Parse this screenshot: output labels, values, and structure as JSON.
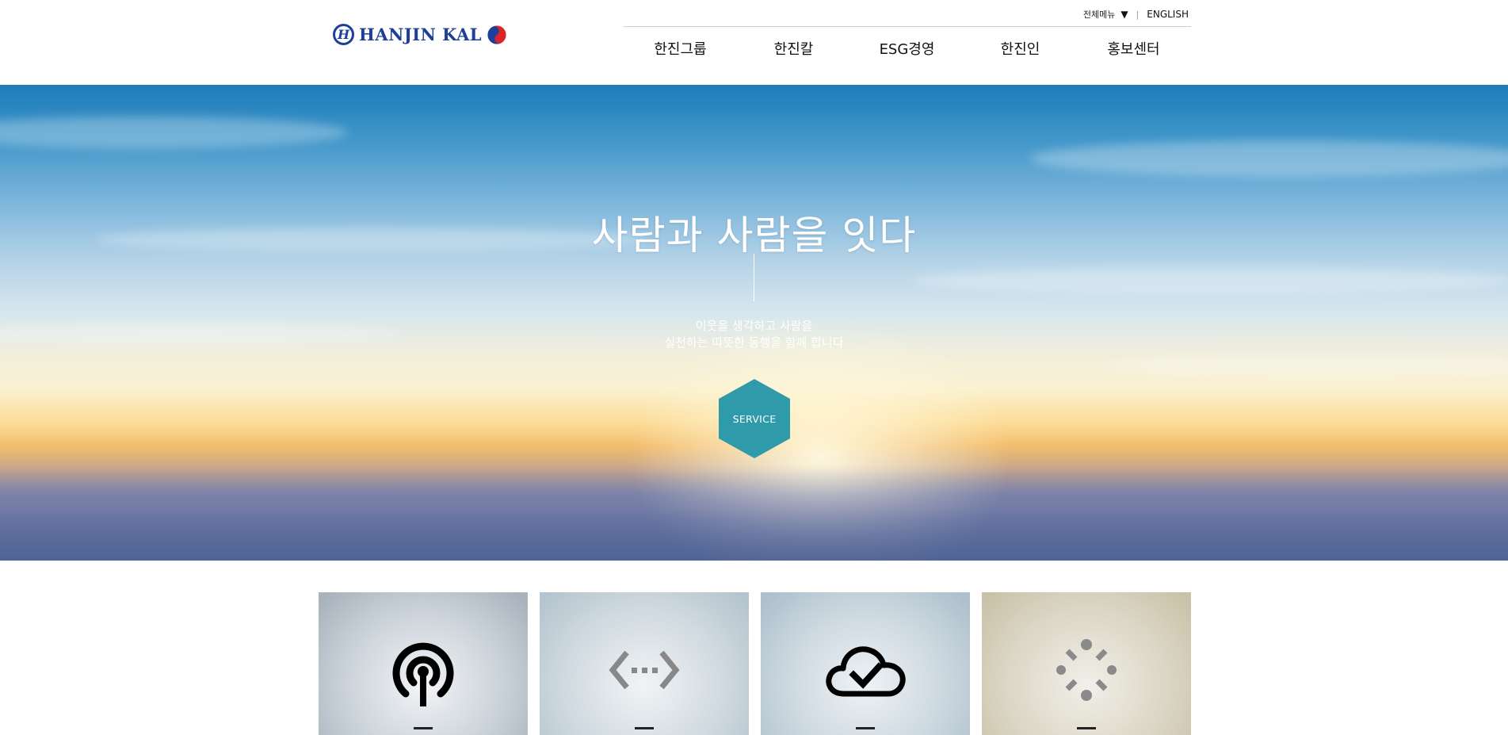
{
  "header": {
    "logo_text": "HANJIN KAL",
    "logo_h": "H",
    "utility": {
      "all_menu": "전체메뉴",
      "toggle_glyph": "▼",
      "separator": "|",
      "english": "ENGLISH"
    },
    "nav": [
      {
        "label": "한진그룹"
      },
      {
        "label": "한진칼"
      },
      {
        "label": "ESG경영"
      },
      {
        "label": "한진인"
      },
      {
        "label": "홍보센터"
      }
    ]
  },
  "hero": {
    "title": "사람과 사람을 잇다",
    "subtitle_line1": "이웃을 생각하고 사랑을",
    "subtitle_line2": "실천하는 따뜻한 동행을 함께 합니다",
    "service_button": "SERVICE"
  },
  "cards": [
    {
      "icon": "broadcast-antenna-icon"
    },
    {
      "icon": "code-brackets-icon"
    },
    {
      "icon": "cloud-check-icon"
    },
    {
      "icon": "loading-spinner-icon"
    }
  ],
  "colors": {
    "brand_navy": "#1d3f9a",
    "service_hex": "#2f9aa9",
    "sky_top": "#1d7cb8",
    "horizon": "#fcdc97"
  }
}
